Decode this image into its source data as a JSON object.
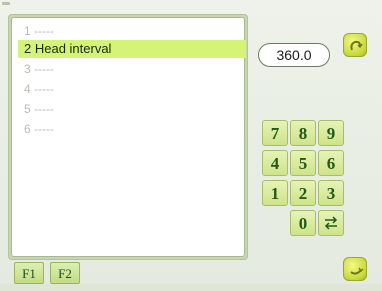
{
  "list": {
    "items": [
      {
        "label": "1 -----",
        "selected": false
      },
      {
        "label": "2 Head interval",
        "selected": true
      },
      {
        "label": "3 -----",
        "selected": false
      },
      {
        "label": "4 -----",
        "selected": false
      },
      {
        "label": "5 -----",
        "selected": false
      },
      {
        "label": "6 -----",
        "selected": false
      }
    ]
  },
  "value": "360.0",
  "keypad": {
    "keys": [
      "7",
      "8",
      "9",
      "4",
      "5",
      "6",
      "1",
      "2",
      "3",
      "0"
    ],
    "enter_icon": "enter-arrows-icon"
  },
  "buttons": {
    "top_icon": "confirm-curl-icon",
    "bottom_icon": "back-curl-icon"
  },
  "tabs": [
    "F1",
    "F2"
  ],
  "colors": {
    "accent": "#d5f377",
    "key_text": "#1f5a1a",
    "panel": "#c7d5b2"
  }
}
